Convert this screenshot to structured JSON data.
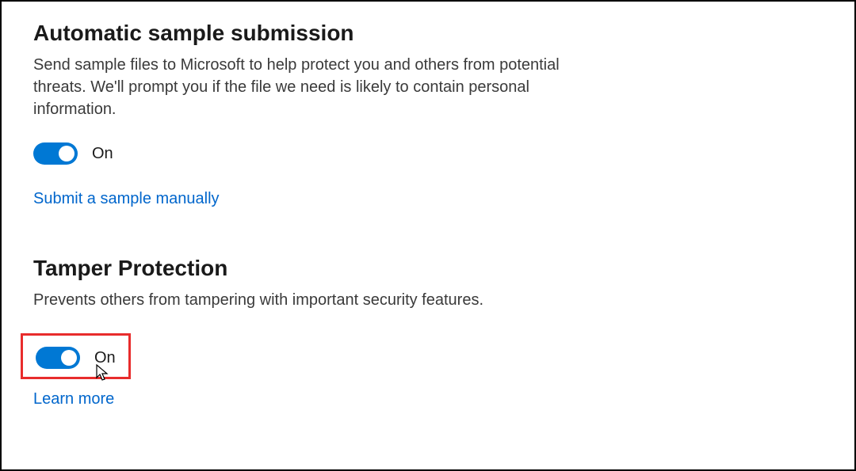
{
  "sections": {
    "automaticSampleSubmission": {
      "title": "Automatic sample submission",
      "description": "Send sample files to Microsoft to help protect you and others from potential threats. We'll prompt you if the file we need is likely to contain personal information.",
      "toggle": {
        "state": true,
        "label": "On"
      },
      "link": "Submit a sample manually"
    },
    "tamperProtection": {
      "title": "Tamper Protection",
      "description": "Prevents others from tampering with important security features.",
      "toggle": {
        "state": true,
        "label": "On"
      },
      "link": "Learn more"
    }
  },
  "colors": {
    "accent": "#0078d4",
    "highlight": "#e82c2c",
    "link": "#0066cc"
  }
}
